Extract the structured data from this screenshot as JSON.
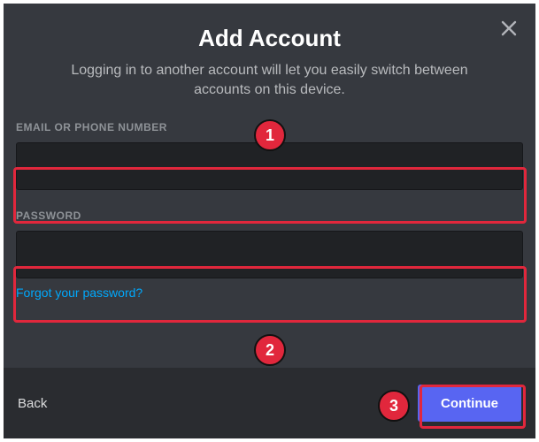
{
  "modal": {
    "title": "Add Account",
    "subtitle": "Logging in to another account will let you easily switch between accounts on this device."
  },
  "fields": {
    "email": {
      "label": "EMAIL OR PHONE NUMBER",
      "value": ""
    },
    "password": {
      "label": "PASSWORD",
      "value": ""
    }
  },
  "links": {
    "forgot": "Forgot your password?"
  },
  "actions": {
    "back": "Back",
    "continue": "Continue"
  },
  "annotations": {
    "badge1": "1",
    "badge2": "2",
    "badge3": "3"
  },
  "colors": {
    "background": "#36393f",
    "input_bg": "#202225",
    "footer_bg": "#2a2c30",
    "primary": "#5865f2",
    "link": "#00a8fc",
    "annotation": "#e1273c"
  }
}
